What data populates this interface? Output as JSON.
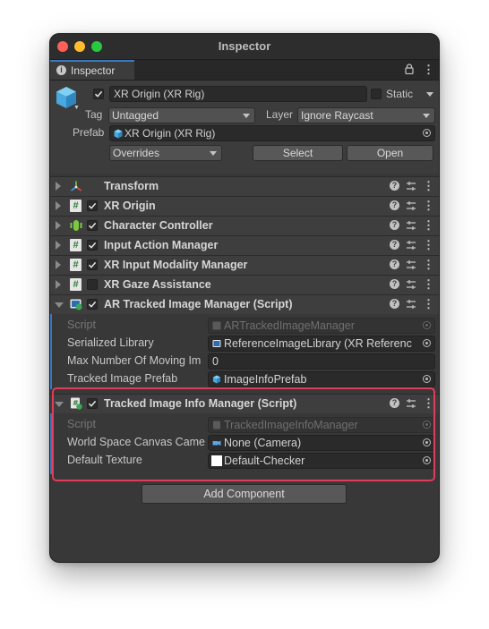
{
  "window": {
    "title": "Inspector"
  },
  "tab": {
    "label": "Inspector",
    "info_glyph": "i"
  },
  "gameobject": {
    "name": "XR Origin (XR Rig)",
    "static_label": "Static",
    "tag_label": "Tag",
    "tag_value": "Untagged",
    "layer_label": "Layer",
    "layer_value": "Ignore Raycast",
    "prefab_label": "Prefab",
    "prefab_value": "XR Origin (XR Rig)",
    "overrides_label": "Overrides",
    "select_label": "Select",
    "open_label": "Open"
  },
  "components": [
    {
      "name": "Transform",
      "icon": "transform-icon",
      "enabled": null
    },
    {
      "name": "XR Origin",
      "icon": "script-icon",
      "enabled": true
    },
    {
      "name": "Character Controller",
      "icon": "character-controller-icon",
      "enabled": true
    },
    {
      "name": "Input Action Manager",
      "icon": "script-icon",
      "enabled": true
    },
    {
      "name": "XR Input Modality Manager",
      "icon": "script-icon",
      "enabled": true
    },
    {
      "name": "XR Gaze Assistance",
      "icon": "script-icon",
      "enabled": false
    },
    {
      "name": "AR Tracked Image Manager (Script)",
      "icon": "ar-tracked-image-icon",
      "enabled": true
    }
  ],
  "ar_manager_props": [
    {
      "label": "Script",
      "value": "ARTrackedImageManager",
      "dim": true
    },
    {
      "label": "Serialized Library",
      "value": "ReferenceImageLibrary (XR Referenc"
    },
    {
      "label": "Max Number Of Moving Im",
      "value": "0"
    },
    {
      "label": "Tracked Image Prefab",
      "value": "ImageInfoPrefab"
    }
  ],
  "info_manager": {
    "name": "Tracked Image Info Manager (Script)",
    "props": [
      {
        "label": "Script",
        "value": "TrackedImageInfoManager",
        "dim": true
      },
      {
        "label": "World Space Canvas Came",
        "value": "None (Camera)"
      },
      {
        "label": "Default Texture",
        "value": "Default-Checker"
      }
    ]
  },
  "icons": {
    "help_glyph": "?",
    "hash_glyph": "#",
    "kebab_glyph": "⋮"
  },
  "add_component_label": "Add Component",
  "colors": {
    "accent": "#3a79bb",
    "highlight": "#e03c5c",
    "panel": "#383838"
  }
}
